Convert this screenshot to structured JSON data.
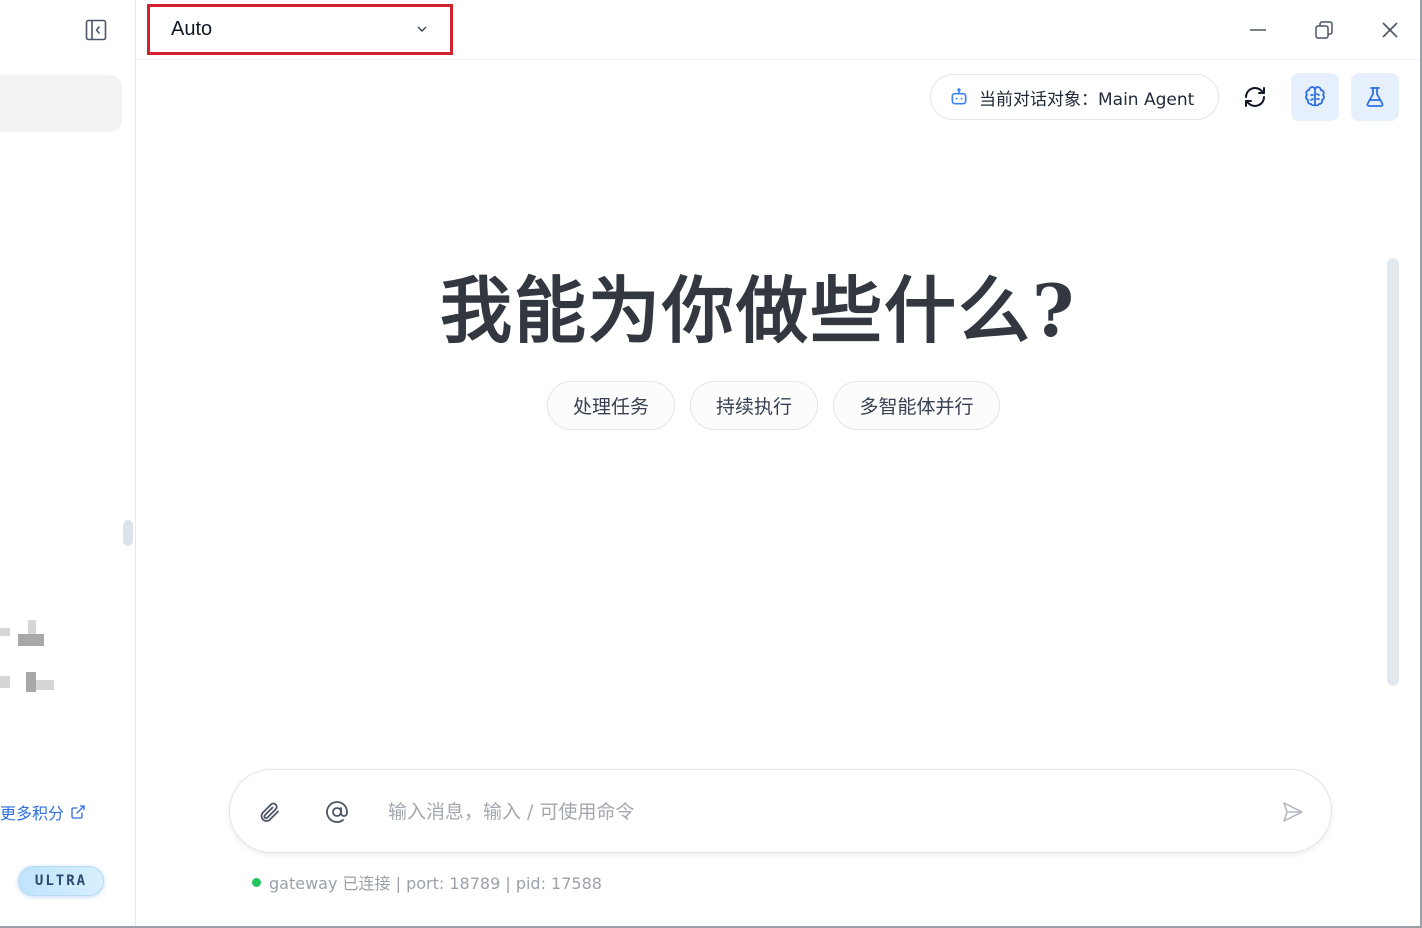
{
  "window": {
    "title": ""
  },
  "sidebar": {
    "more_credits_label": "更多积分",
    "plan_badge": "ULTRA"
  },
  "titlebar": {
    "model_select_value": "Auto"
  },
  "toolbar": {
    "agent_label": "当前对话对象：",
    "agent_name": "Main Agent"
  },
  "hero": {
    "title": "我能为你做些什么?"
  },
  "suggestions": [
    {
      "label": "处理任务"
    },
    {
      "label": "持续执行"
    },
    {
      "label": "多智能体并行"
    }
  ],
  "composer": {
    "placeholder": "输入消息，输入 / 可使用命令",
    "value": ""
  },
  "status": {
    "text": "gateway 已连接 | port: 18789 | pid: 17588",
    "color": "#22c55e"
  },
  "colors": {
    "accent": "#2f6fde",
    "highlight_border": "#d3212d",
    "icon_button_bg": "#e6effc"
  }
}
